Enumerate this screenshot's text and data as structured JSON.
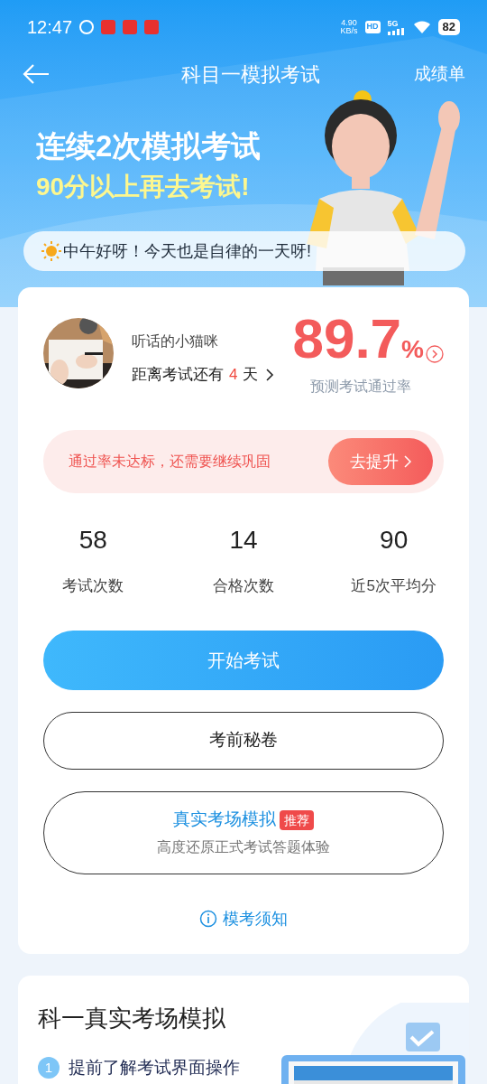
{
  "status_bar": {
    "time": "12:47",
    "net_speed_value": "4.90",
    "net_speed_unit": "KB/s",
    "hd": "HD",
    "network": "5G",
    "battery": "82"
  },
  "header": {
    "title": "科目一模拟考试",
    "right_link": "成绩单"
  },
  "banner": {
    "line_1": "连续2次模拟考试",
    "line_2": "90分以上再去考试!",
    "greeting": "中午好呀！今天也是自律的一天呀!"
  },
  "profile": {
    "name": "听话的小猫咪",
    "countdown_prefix": "距离考试还有",
    "countdown_days": "4",
    "countdown_suffix": "天",
    "pass_rate": "89.7",
    "pass_rate_unit": "%",
    "pass_rate_label": "预测考试通过率"
  },
  "alert": {
    "message": "通过率未达标，还需要继续巩固",
    "button": "去提升"
  },
  "stats": [
    {
      "value": "58",
      "label": "考试次数"
    },
    {
      "value": "14",
      "label": "合格次数"
    },
    {
      "value": "90",
      "label": "近5次平均分"
    }
  ],
  "actions": [
    {
      "kind": "primary",
      "label": "开始考试"
    },
    {
      "kind": "outline",
      "label": "考前秘卷"
    },
    {
      "kind": "feature",
      "label": "真实考场模拟",
      "tag": "推荐",
      "subtitle": "高度还原正式考试答题体验"
    }
  ],
  "notice_link": "模考须知",
  "section": {
    "title": "科一真实考场模拟",
    "steps": [
      {
        "number": "1",
        "text": "提前了解考试界面操作"
      }
    ]
  }
}
